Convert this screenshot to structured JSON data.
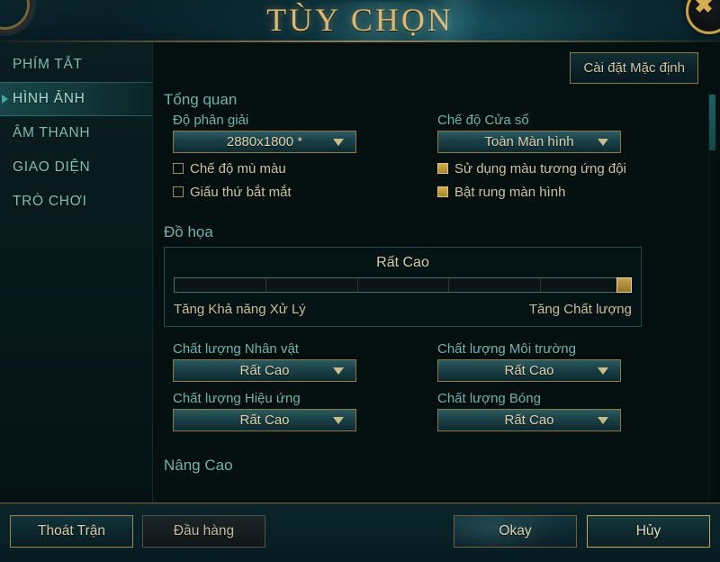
{
  "window": {
    "title": "TÙY CHỌN",
    "close_icon": "close-x-icon"
  },
  "sidebar": {
    "items": [
      {
        "label": "PHÍM TẮT",
        "active": false
      },
      {
        "label": "HÌNH ẢNH",
        "active": true
      },
      {
        "label": "ÂM THANH",
        "active": false
      },
      {
        "label": "GIAO DIỆN",
        "active": false
      },
      {
        "label": "TRÒ CHƠI",
        "active": false
      }
    ]
  },
  "content": {
    "default_button": "Cài đặt Mặc định",
    "overview": {
      "section_title": "Tổng quan",
      "resolution_label": "Độ phân giải",
      "resolution_value": "2880x1800 *",
      "window_mode_label": "Chế độ Cửa sổ",
      "window_mode_value": "Toàn Màn hình",
      "checkboxes": [
        {
          "label": "Chế độ mù màu",
          "checked": false
        },
        {
          "label": "Giấu thứ bắt mắt",
          "checked": false
        },
        {
          "label": "Sử dụng màu tương ứng đội",
          "checked": true
        },
        {
          "label": "Bật rung màn hình",
          "checked": true
        }
      ]
    },
    "graphics": {
      "section_title": "Đồ họa",
      "slider_value": "Rất Cao",
      "slider_left_label": "Tăng Khả năng Xử Lý",
      "slider_right_label": "Tăng Chất lượng",
      "slider_percent": 100,
      "quality": [
        {
          "label": "Chất lượng Nhân vật",
          "value": "Rất Cao"
        },
        {
          "label": "Chất lượng Môi trường",
          "value": "Rất Cao"
        },
        {
          "label": "Chất lượng Hiệu ứng",
          "value": "Rất Cao"
        },
        {
          "label": "Chất lượng Bóng",
          "value": "Rất Cao"
        }
      ]
    },
    "advanced": {
      "section_title": "Nâng Cao"
    }
  },
  "footer": {
    "exit_label": "Thoát Trận",
    "surrender_label": "Đầu hàng",
    "okay_label": "Okay",
    "cancel_label": "Hủy"
  },
  "colors": {
    "gold": "#c9a44c",
    "teal": "#6fb7ae",
    "panel_bg": "#03100f",
    "accent_border": "#8c7a4c"
  }
}
